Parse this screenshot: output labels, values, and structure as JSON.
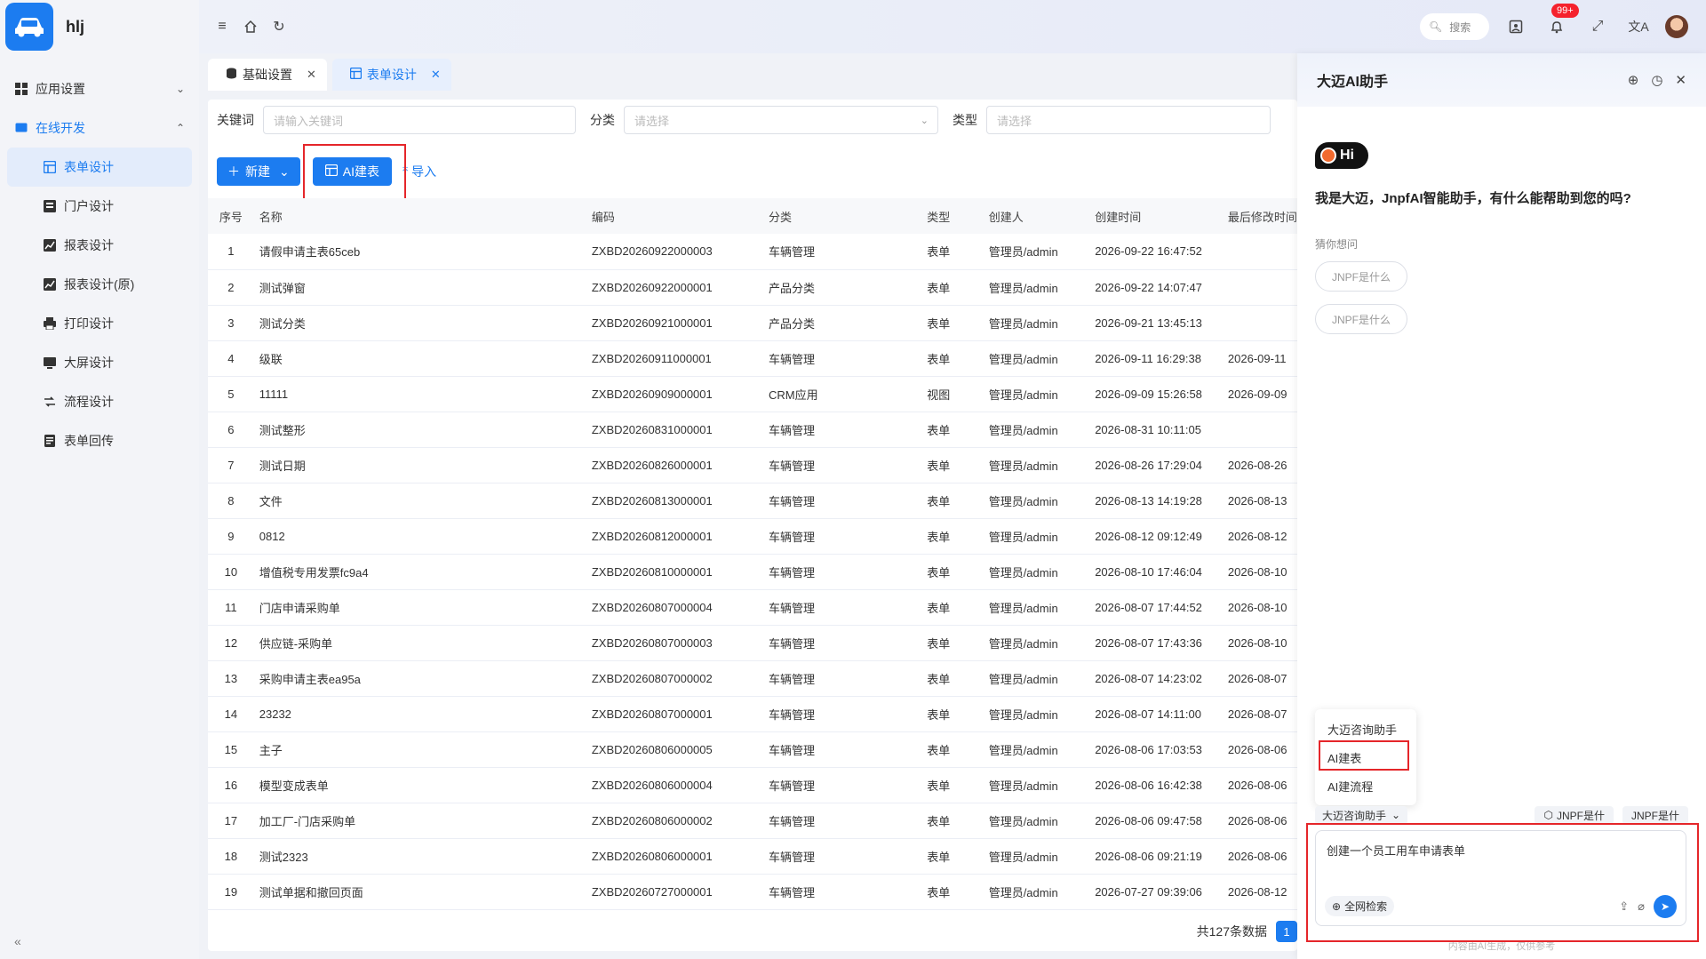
{
  "app": {
    "name": "hlj"
  },
  "sidebar": {
    "groups": [
      {
        "label": "应用设置"
      },
      {
        "label": "在线开发"
      }
    ],
    "items": [
      {
        "label": "表单设计"
      },
      {
        "label": "门户设计"
      },
      {
        "label": "报表设计"
      },
      {
        "label": "报表设计(原)"
      },
      {
        "label": "打印设计"
      },
      {
        "label": "大屏设计"
      },
      {
        "label": "流程设计"
      },
      {
        "label": "表单回传"
      }
    ]
  },
  "topbar": {
    "search_label": "搜索",
    "notification_badge": "99+"
  },
  "tabs": [
    {
      "label": "基础设置"
    },
    {
      "label": "表单设计"
    }
  ],
  "filters": {
    "keyword_label": "关键词",
    "keyword_placeholder": "请输入关键词",
    "category_label": "分类",
    "category_placeholder": "请选择",
    "type_label": "类型",
    "type_placeholder": "请选择"
  },
  "toolbar": {
    "new_label": "新建",
    "ai_build_label": "AI建表",
    "import_label": "导入"
  },
  "table": {
    "headers": [
      "序号",
      "名称",
      "编码",
      "分类",
      "类型",
      "创建人",
      "创建时间",
      "最后修改时间"
    ],
    "rows": [
      [
        "1",
        "请假申请主表65ceb",
        "ZXBD20260922000003",
        "车辆管理",
        "表单",
        "管理员/admin",
        "2026-09-22 16:47:52",
        ""
      ],
      [
        "2",
        "测试弹窗",
        "ZXBD20260922000001",
        "产品分类",
        "表单",
        "管理员/admin",
        "2026-09-22 14:07:47",
        ""
      ],
      [
        "3",
        "测试分类",
        "ZXBD20260921000001",
        "产品分类",
        "表单",
        "管理员/admin",
        "2026-09-21 13:45:13",
        ""
      ],
      [
        "4",
        "级联",
        "ZXBD20260911000001",
        "车辆管理",
        "表单",
        "管理员/admin",
        "2026-09-11 16:29:38",
        "2026-09-11"
      ],
      [
        "5",
        "11111",
        "ZXBD20260909000001",
        "CRM应用",
        "视图",
        "管理员/admin",
        "2026-09-09 15:26:58",
        "2026-09-09"
      ],
      [
        "6",
        "测试整形",
        "ZXBD20260831000001",
        "车辆管理",
        "表单",
        "管理员/admin",
        "2026-08-31 10:11:05",
        ""
      ],
      [
        "7",
        "测试日期",
        "ZXBD20260826000001",
        "车辆管理",
        "表单",
        "管理员/admin",
        "2026-08-26 17:29:04",
        "2026-08-26"
      ],
      [
        "8",
        "文件",
        "ZXBD20260813000001",
        "车辆管理",
        "表单",
        "管理员/admin",
        "2026-08-13 14:19:28",
        "2026-08-13"
      ],
      [
        "9",
        "0812",
        "ZXBD20260812000001",
        "车辆管理",
        "表单",
        "管理员/admin",
        "2026-08-12 09:12:49",
        "2026-08-12"
      ],
      [
        "10",
        "增值税专用发票fc9a4",
        "ZXBD20260810000001",
        "车辆管理",
        "表单",
        "管理员/admin",
        "2026-08-10 17:46:04",
        "2026-08-10"
      ],
      [
        "11",
        "门店申请采购单",
        "ZXBD20260807000004",
        "车辆管理",
        "表单",
        "管理员/admin",
        "2026-08-07 17:44:52",
        "2026-08-10"
      ],
      [
        "12",
        "供应链-采购单",
        "ZXBD20260807000003",
        "车辆管理",
        "表单",
        "管理员/admin",
        "2026-08-07 17:43:36",
        "2026-08-10"
      ],
      [
        "13",
        "采购申请主表ea95a",
        "ZXBD20260807000002",
        "车辆管理",
        "表单",
        "管理员/admin",
        "2026-08-07 14:23:02",
        "2026-08-07"
      ],
      [
        "14",
        "23232",
        "ZXBD20260807000001",
        "车辆管理",
        "表单",
        "管理员/admin",
        "2026-08-07 14:11:00",
        "2026-08-07"
      ],
      [
        "15",
        "主子",
        "ZXBD20260806000005",
        "车辆管理",
        "表单",
        "管理员/admin",
        "2026-08-06 17:03:53",
        "2026-08-06"
      ],
      [
        "16",
        "模型变成表单",
        "ZXBD20260806000004",
        "车辆管理",
        "表单",
        "管理员/admin",
        "2026-08-06 16:42:38",
        "2026-08-06"
      ],
      [
        "17",
        "加工厂-门店采购单",
        "ZXBD20260806000002",
        "车辆管理",
        "表单",
        "管理员/admin",
        "2026-08-06 09:47:58",
        "2026-08-06"
      ],
      [
        "18",
        "测试2323",
        "ZXBD20260806000001",
        "车辆管理",
        "表单",
        "管理员/admin",
        "2026-08-06 09:21:19",
        "2026-08-06"
      ],
      [
        "19",
        "测试单据和撤回页面",
        "ZXBD20260727000001",
        "车辆管理",
        "表单",
        "管理员/admin",
        "2026-07-27 09:39:06",
        "2026-08-12"
      ]
    ]
  },
  "pagination": {
    "total_text": "共127条数据",
    "current_page": "1"
  },
  "ai_panel": {
    "title": "大迈AI助手",
    "hi": "Hi",
    "greeting": "我是大迈，JnpfAI智能助手，有什么能帮助到您的吗?",
    "guess_label": "猜你想问",
    "suggestions": [
      "JNPF是什么",
      "JNPF是什么"
    ],
    "mode_options": [
      "大迈咨询助手",
      "AI建表",
      "AI建流程"
    ],
    "current_mode": "大迈咨询助手",
    "quick_chips": [
      "JNPF是什",
      "JNPF是什"
    ],
    "input_value": "创建一个员工用车申请表单",
    "web_search_label": "全网检索",
    "disclaimer": "内容由AI生成，仅供参考"
  },
  "colors": {
    "accent": "#1c7cf0",
    "highlight_box": "#e5262a",
    "badge": "#f5222d"
  }
}
